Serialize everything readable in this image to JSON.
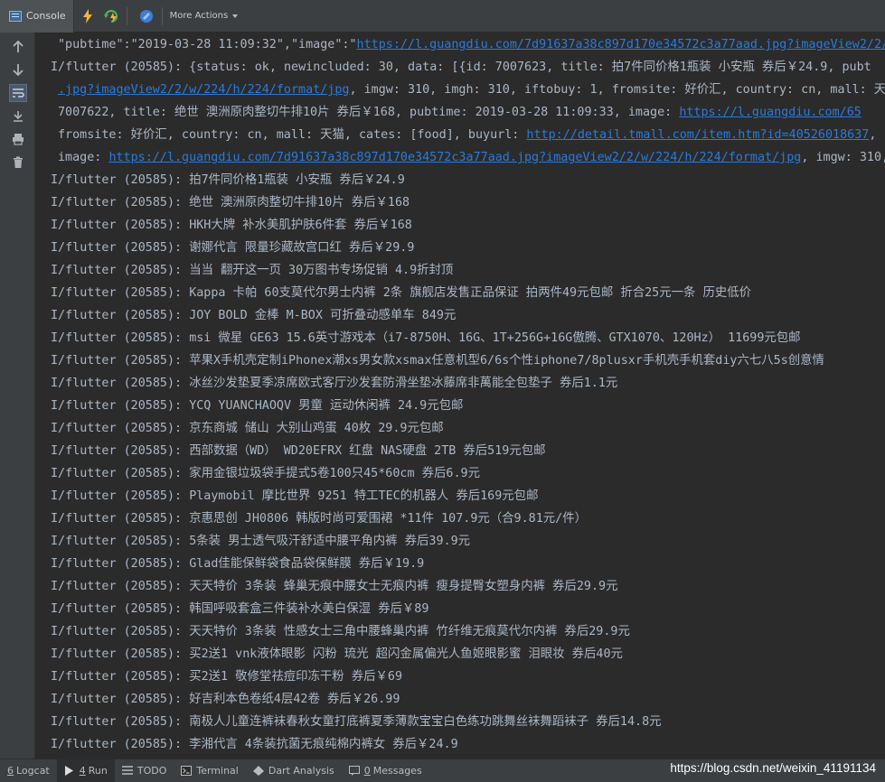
{
  "toolbar": {
    "console_tab": "Console",
    "more_actions": "More Actions"
  },
  "console": {
    "head": [
      {
        "text": "\"pubtime\":\"2019-03-28 11:09:32\",\"image\":\"",
        "link": "https://l.guangdiu.com/7d91637a38c897d170e34572c3a77aad.jpg?imageView2/2/w",
        "tail": ""
      },
      {
        "text": "I/flutter (20585): {status: ok, newincluded: 30, data: [{id: 7007623, title: 拍7件同价格1瓶装 小安瓶 券后￥24.9, pubt",
        "link": "",
        "tail": ""
      },
      {
        "text": "",
        "link": ".jpg?imageView2/2/w/224/h/224/format/jpg",
        "tail": ", imgw: 310, imgh: 310, iftobuy: 1, fromsite: 好价汇, country: cn, mall: 天"
      },
      {
        "text": "7007622, title: 绝世 澳洲原肉整切牛排10片 券后￥168, pubtime: 2019-03-28 11:09:33, image: ",
        "link": "https://l.guangdiu.com/65",
        "tail": ""
      },
      {
        "text": "fromsite: 好价汇, country: cn, mall: 天猫, cates: [food], buyurl: ",
        "link": "http://detail.tmall.com/item.htm?id=40526018637",
        "tail": ","
      },
      {
        "text": "image: ",
        "link": "https://l.guangdiu.com/7d91637a38c897d170e34572c3a77aad.jpg?imageView2/2/w/224/h/224/format/jpg",
        "tail": ", imgw: 310,"
      }
    ],
    "prefix": "I/flutter (20585): ",
    "titles": [
      "拍7件同价格1瓶装 小安瓶 券后￥24.9",
      "绝世 澳洲原肉整切牛排10片 券后￥168",
      "HKH大牌 补水美肌护肤6件套 券后￥168",
      "谢娜代言 限量珍藏故宫口红 券后￥29.9",
      "当当 翻开这一页 30万图书专场促销 4.9折封顶",
      "Kappa 卡帕 60支莫代尔男士内裤 2条 旗舰店发售正品保证 拍两件49元包邮 折合25元一条 历史低价",
      "JOY BOLD 金棒 M-BOX 可折叠动感单车 849元",
      "msi 微星 GE63 15.6英寸游戏本（i7-8750H、16G、1T+256G+16G傲腾、GTX1070、120Hz） 11699元包邮",
      "苹果X手机壳定制iPhonex潮xs男女款xsmax任意机型6/6s个性iphone7/8plusxr手机壳手机套diy六七八5s创意情",
      "冰丝沙发垫夏季凉席欧式客厅沙发套防滑坐垫冰藤席非萬能全包垫子 券后1.1元",
      "YCQ YUANCHAOQV 男童 运动休闲裤 24.9元包邮",
      "京东商城 储山 大别山鸡蛋 40枚 29.9元包邮",
      "西部数据（WD） WD20EFRX 红盘 NAS硬盘 2TB  券后519元包邮",
      "家用金银垃圾袋手提式5卷100只45*60cm  券后6.9元",
      "Playmobil 摩比世界 9251 特工TEC的机器人  券后169元包邮",
      "京惠思创 JH0806 韩版时尚可爱围裙 *11件 107.9元（合9.81元/件）",
      "5条装 男士透气吸汗舒适中腰平角内裤 券后39.9元",
      "Glad佳能保鲜袋食品袋保鲜膜 券后￥19.9",
      "天天特价 3条装 蜂巢无痕中腰女士无痕内裤 瘦身提臀女塑身内裤 券后29.9元",
      "韩国呼吸套盒三件装补水美白保湿 券后￥89",
      "天天特价 3条装 性感女士三角中腰蜂巢内裤 竹纤维无痕莫代尔内裤 券后29.9元",
      "买2送1 vnk液体眼影 闪粉 琉光 超闪金属偏光人鱼姬眼影蜜 泪眼妆 券后40元",
      "买2送1 敬修堂祛痘印冻干粉 券后￥69",
      "好吉利本色卷纸4层42卷 券后￥26.99",
      "南极人儿童连裤袜春秋女童打底裤夏季薄款宝宝白色练功跳舞丝袜舞蹈袜子 券后14.8元",
      "李湘代言 4条装抗菌无痕纯棉内裤女 券后￥24.9"
    ]
  },
  "bottom": {
    "logcat_num": "6",
    "logcat": "Logcat",
    "run_num": "4",
    "run": "Run",
    "todo": "TODO",
    "terminal": "Terminal",
    "dart": "Dart Analysis",
    "messages_num": "0",
    "messages": "Messages"
  },
  "watermark": "https://blog.csdn.net/weixin_41191134",
  "colors": {
    "background": "#2b2b2b",
    "panel": "#3c3f41",
    "text": "#a9b7c6",
    "link": "#287bde"
  }
}
